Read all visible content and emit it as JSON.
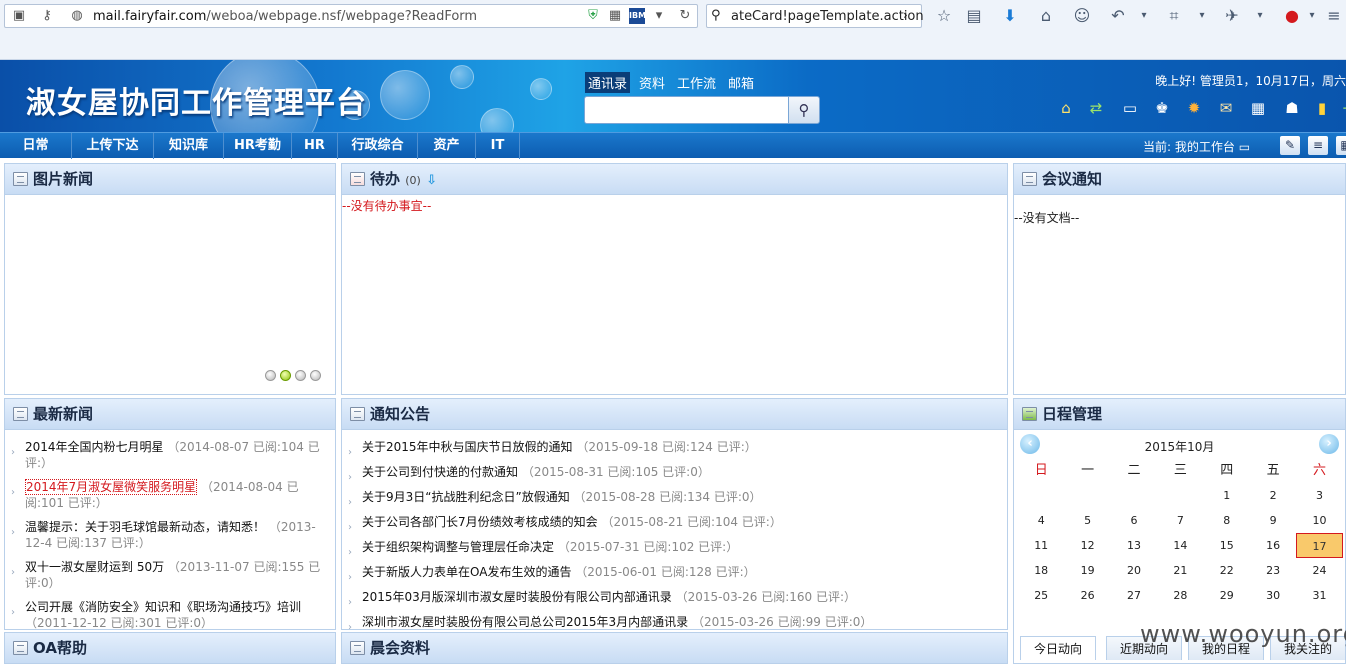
{
  "browser": {
    "url_host": "mail.fairyfair.com",
    "url_path": "/weboa/webpage.nsf/webpage?ReadForm",
    "search_text": "ateCard!pageTemplate.action"
  },
  "header": {
    "logo": "淑女屋协同工作管理平台",
    "top_nav": [
      "通讯录",
      "资料",
      "工作流",
      "邮箱"
    ],
    "greeting": "晚上好! 管理员1，10月17日，周六"
  },
  "main_nav": {
    "items": [
      "日常",
      "上传下达",
      "知识库",
      "HR考勤",
      "HR",
      "行政综合",
      "资产",
      "IT"
    ],
    "current": "当前: 我的工作台"
  },
  "panels": {
    "photo_news": {
      "title": "图片新闻"
    },
    "todo": {
      "title": "待办",
      "count": "(0)",
      "empty": "--没有待办事宜--"
    },
    "meeting": {
      "title": "会议通知",
      "empty": "--没有文档--"
    },
    "latest_news": {
      "title": "最新新闻",
      "items": [
        {
          "title": "2014年全国内粉七月明星",
          "meta": "（2014-08-07 已阅:104 已评:）",
          "highlight": false
        },
        {
          "title": "2014年7月淑女屋微笑服务明星",
          "meta": "（2014-08-04 已阅:101 已评:）",
          "highlight": true
        },
        {
          "title": "温馨提示：关于羽毛球馆最新动态，请知悉！",
          "meta": "（2013-12-4 已阅:137 已评:）",
          "highlight": false
        },
        {
          "title": "双十一淑女屋财运到 50万",
          "meta": "（2013-11-07 已阅:155 已评:0）",
          "highlight": false
        },
        {
          "title": "公司开展《消防安全》知识和《职场沟通技巧》培训",
          "meta": "（2011-12-12 已阅:301 已评:0）",
          "highlight": false
        }
      ]
    },
    "notices": {
      "title": "通知公告",
      "items": [
        {
          "title": "关于2015年中秋与国庆节日放假的通知",
          "meta": "（2015-09-18 已阅:124 已评:）"
        },
        {
          "title": "关于公司到付快递的付款通知",
          "meta": "（2015-08-31 已阅:105 已评:0）"
        },
        {
          "title": "关于9月3日“抗战胜利纪念日”放假通知",
          "meta": "（2015-08-28 已阅:134 已评:0）"
        },
        {
          "title": "关于公司各部门长7月份绩效考核成绩的知会",
          "meta": "（2015-08-21 已阅:104 已评:）"
        },
        {
          "title": "关于组织架构调整与管理层任命决定",
          "meta": "（2015-07-31 已阅:102 已评:）"
        },
        {
          "title": "关于新版人力表单在OA发布生效的通告",
          "meta": "（2015-06-01 已阅:128 已评:）"
        },
        {
          "title": "2015年03月版深圳市淑女屋时装股份有限公司内部通讯录",
          "meta": "（2015-03-26 已阅:160 已评:）"
        },
        {
          "title": "深圳市淑女屋时装股份有限公司总公司2015年3月内部通讯录",
          "meta": "（2015-03-26 已阅:99 已评:0）"
        }
      ]
    },
    "schedule": {
      "title": "日程管理",
      "month": "2015年10月",
      "weekdays": [
        "日",
        "一",
        "二",
        "三",
        "四",
        "五",
        "六"
      ],
      "weeks": [
        [
          "",
          "",
          "",
          "",
          "1",
          "2",
          "3"
        ],
        [
          "4",
          "5",
          "6",
          "7",
          "8",
          "9",
          "10"
        ],
        [
          "11",
          "12",
          "13",
          "14",
          "15",
          "16",
          "17"
        ],
        [
          "18",
          "19",
          "20",
          "21",
          "22",
          "23",
          "24"
        ],
        [
          "25",
          "26",
          "27",
          "28",
          "29",
          "30",
          "31"
        ]
      ],
      "today": "17",
      "tabs": [
        "今日动向",
        "近期动向",
        "我的日程",
        "我关注的"
      ]
    },
    "oa_help": {
      "title": "OA帮助"
    },
    "morning": {
      "title": "晨会资料"
    }
  },
  "watermark": "www.wooyun.org",
  "colors": {
    "banner": "#0b6bc6",
    "nav": "#0c5cb0",
    "accent_red": "#d4191e",
    "today_bg": "#f9c96b"
  }
}
